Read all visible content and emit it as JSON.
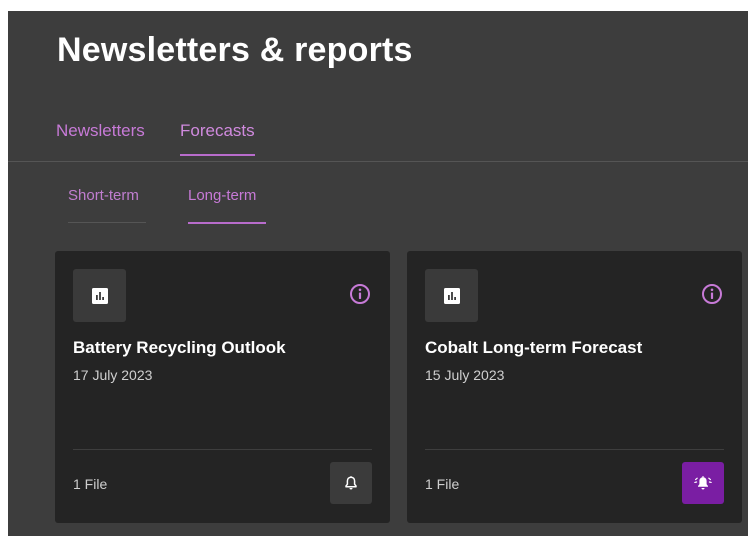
{
  "page": {
    "title": "Newsletters & reports"
  },
  "tabs": [
    {
      "label": "Newsletters",
      "active": false
    },
    {
      "label": "Forecasts",
      "active": true
    }
  ],
  "subtabs": [
    {
      "label": "Short-term",
      "active": false
    },
    {
      "label": "Long-term",
      "active": true
    }
  ],
  "cards": [
    {
      "title": "Battery Recycling Outlook",
      "date": "17 July 2023",
      "files": "1 File",
      "icon": "bar-chart-icon",
      "notification": "bell-icon",
      "subscribed": false
    },
    {
      "title": "Cobalt Long-term Forecast",
      "date": "15 July 2023",
      "files": "1 File",
      "icon": "bar-chart-icon",
      "notification": "bell-ringing-icon",
      "subscribed": true
    }
  ],
  "colors": {
    "background": "#3d3d3d",
    "card": "#242424",
    "accent": "#c77ad7",
    "active_button": "#7a1ea3"
  }
}
